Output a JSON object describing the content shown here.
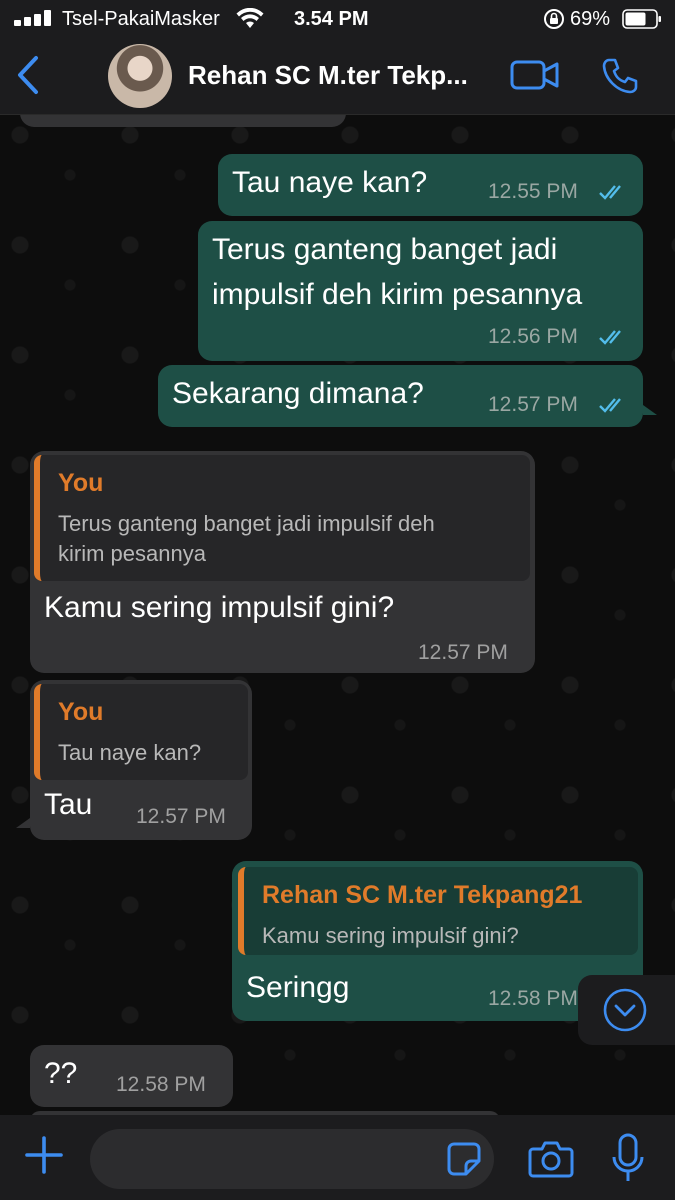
{
  "status_bar": {
    "carrier": "Tsel-PakaiMasker",
    "time": "3.54 PM",
    "battery_percent": "69%",
    "icons": [
      "signal-icon",
      "wifi-icon",
      "orientation-lock-icon",
      "battery-icon"
    ]
  },
  "header": {
    "contact_name": "Rehan SC M.ter Tekp...",
    "icons": [
      "back-icon",
      "avatar",
      "video-call-icon",
      "phone-call-icon"
    ]
  },
  "messages": [
    {
      "direction": "out",
      "text": "Tau naye kan?",
      "time": "12.55 PM",
      "status": "read"
    },
    {
      "direction": "out",
      "text_lines": [
        "Terus ganteng banget jadi",
        "impulsif deh kirim pesannya"
      ],
      "time": "12.56 PM",
      "status": "read"
    },
    {
      "direction": "out",
      "text": "Sekarang dimana?",
      "time": "12.57 PM",
      "status": "read"
    },
    {
      "direction": "in",
      "quote": {
        "author": "You",
        "text_lines": [
          "Terus ganteng banget jadi impulsif deh",
          "kirim pesannya"
        ]
      },
      "text": "Kamu sering impulsif gini?",
      "time": "12.57 PM"
    },
    {
      "direction": "in",
      "quote": {
        "author": "You",
        "text": "Tau naye kan?"
      },
      "text": "Tau",
      "time": "12.57 PM"
    },
    {
      "direction": "out",
      "quote": {
        "author": "Rehan SC M.ter Tekpang21",
        "text": "Kamu sering impulsif gini?"
      },
      "text": "Seringg",
      "time": "12.58 PM"
    },
    {
      "direction": "in",
      "text": "??",
      "time": "12.58 PM"
    }
  ],
  "input_bar": {
    "placeholder": "",
    "icons": [
      "plus-icon",
      "sticker-icon",
      "camera-icon",
      "microphone-icon"
    ]
  },
  "colors": {
    "outgoing_bubble": "#1e4f46",
    "incoming_bubble": "#333335",
    "accent_blue": "#3d8cf0",
    "quote_author": "#e07b2a",
    "read_ticks": "#53bdeb"
  }
}
